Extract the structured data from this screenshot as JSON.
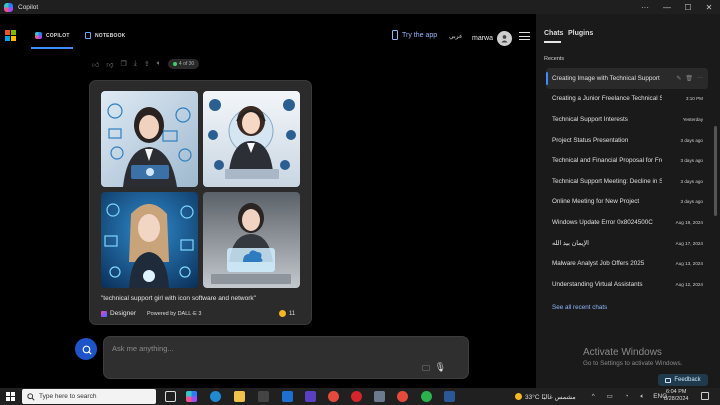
{
  "window": {
    "title": "Copilot"
  },
  "topnav": {
    "tabs": [
      {
        "label": "COPILOT",
        "active": true
      },
      {
        "label": "NOTEBOOK",
        "active": false
      }
    ],
    "try_app": "Try the app",
    "language": "عربي",
    "username": "marwa"
  },
  "message_toolbar": {
    "counter": "4 of 30"
  },
  "image_card": {
    "prompt": "\"technical support girl with icon software and network\"",
    "designer_label": "Designer",
    "powered_by": "Powered by DALL·E 3",
    "reaction_count": "11"
  },
  "composer": {
    "placeholder": "Ask me anything..."
  },
  "panel": {
    "tabs": [
      {
        "label": "Chats",
        "active": true
      },
      {
        "label": "Plugins",
        "active": false
      }
    ],
    "recents_label": "Recents",
    "chats": [
      {
        "title": "Creating Image with Technical Support",
        "date": "",
        "active": true
      },
      {
        "title": "Creating a Junior Freelance Technical Support",
        "date": "3:10 PM"
      },
      {
        "title": "Technical Support Interests",
        "date": "Yesterday"
      },
      {
        "title": "Project Status Presentation",
        "date": "3 days ago"
      },
      {
        "title": "Technical and Financial Proposal for Freelance",
        "date": "3 days ago"
      },
      {
        "title": "Technical Support Meeting: Decline in Sales",
        "date": "3 days ago"
      },
      {
        "title": "Online Meeting for New Project",
        "date": "3 days ago"
      },
      {
        "title": "Windows Update Error 0x8024500C",
        "date": "Aug 19, 2024"
      },
      {
        "title": "الإيمان بيد الله",
        "date": "Aug 17, 2024"
      },
      {
        "title": "Malware Analyst Job Offers 2025",
        "date": "Aug 13, 2024"
      },
      {
        "title": "Understanding Virtual Assistants",
        "date": "Aug 12, 2024"
      }
    ],
    "see_all": "See all recent chats"
  },
  "watermark": {
    "line1": "Activate Windows",
    "line2": "Go to Settings to activate Windows."
  },
  "feedback": "Feedback",
  "taskbar": {
    "search_placeholder": "Type here to search",
    "weather": "33°C  مشمس غالبًا",
    "lang": "ENG",
    "time": "6:04 PM",
    "date": "8/28/2024"
  },
  "colors": {
    "accent": "#3f8cff",
    "link": "#8fb8ff",
    "panel": "#1a1a1a",
    "card": "#2b2b2b"
  },
  "icons": [
    "copilot-logo-icon",
    "microsoft-logo-icon",
    "notebook-icon",
    "phone-icon",
    "user-icon",
    "menu-icon",
    "thumbs-up-icon",
    "thumbs-down-icon",
    "copy-icon",
    "download-icon",
    "share-icon",
    "speaker-icon",
    "emoji-icon",
    "broom-icon",
    "microphone-icon",
    "edit-icon",
    "delete-icon",
    "more-icon",
    "windows-start-icon",
    "search-icon"
  ]
}
